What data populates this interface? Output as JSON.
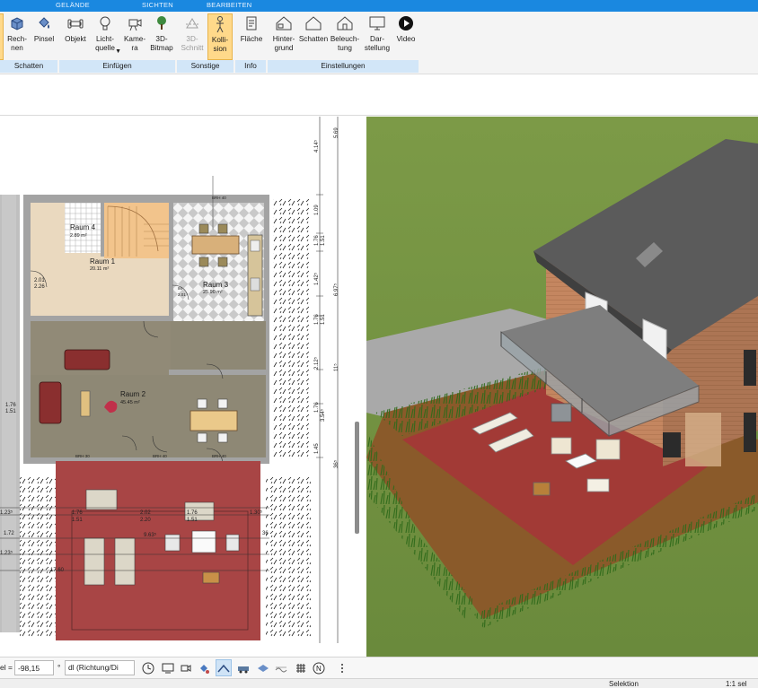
{
  "ribbon": {
    "tabs": [
      "GELÄNDE",
      "SICHTEN",
      "BEARBEITEN"
    ],
    "buttons": {
      "rechnen": "Rech-\nnen",
      "pinsel": "Pinsel",
      "objekt": "Objekt",
      "lichtquelle": "Licht-\nquelle",
      "kamera": "Kame-\nra",
      "bitmap": "3D-\nBitmap",
      "schnitt": "3D-\nSchnitt",
      "kollision": "Kolli-\nsion",
      "flaeche": "Fläche",
      "hintergrund": "Hinter-\ngrund",
      "schatten": "Schatten",
      "beleuchtung": "Beleuch-\ntung",
      "darstellung": "Dar-\nstellung",
      "video": "Video"
    },
    "groups": [
      "Schatten",
      "Einfügen",
      "Sonstige",
      "Info",
      "Einstellungen"
    ]
  },
  "plan": {
    "rooms": [
      {
        "name": "Raum 4",
        "area": "2.89 m²"
      },
      {
        "name": "Raum 1",
        "area": "20.11 m²"
      },
      {
        "name": "Raum 3",
        "area": "25.90 m²"
      },
      {
        "name": "Raum 2",
        "area": "45.45 m²"
      }
    ],
    "dim_right": [
      "5.69",
      "4.14⁵",
      "1.09",
      "1.76",
      "1.51",
      "6.97⁵",
      "1.42⁵",
      "1.76",
      "1.51",
      "2.12⁵",
      "11⁵",
      "1.76",
      "3.54⁵",
      "1.45",
      "36⁵"
    ],
    "dim_left": [
      "2.01",
      "2.26",
      "1.76",
      "1.51"
    ],
    "dim_terrace": [
      "1.76",
      "1.51",
      "2.02",
      "2.20",
      "1.76",
      "1.51",
      "9.63⁵",
      "1.23⁵",
      "1.72",
      "1.23⁵",
      "1.30⁵",
      "36",
      "17.60"
    ],
    "door_labels": [
      "86",
      "2.01",
      "BRH 30",
      "BRH 40",
      "BRH 40",
      "BRH 40"
    ]
  },
  "toolbar": {
    "left_label": "el =",
    "value": "-98,15",
    "unit": "°",
    "mode_select": "dl (Richtung/Di"
  },
  "status": {
    "mode": "Selektion",
    "scale": "1:1 sel"
  },
  "colors": {
    "ribbon_tab_bar": "#1a88e0",
    "group_bar": "#d2e6f8",
    "active_button": "#ffd98a",
    "terrace": "#a84545",
    "lawn": "#7d9a4a"
  }
}
